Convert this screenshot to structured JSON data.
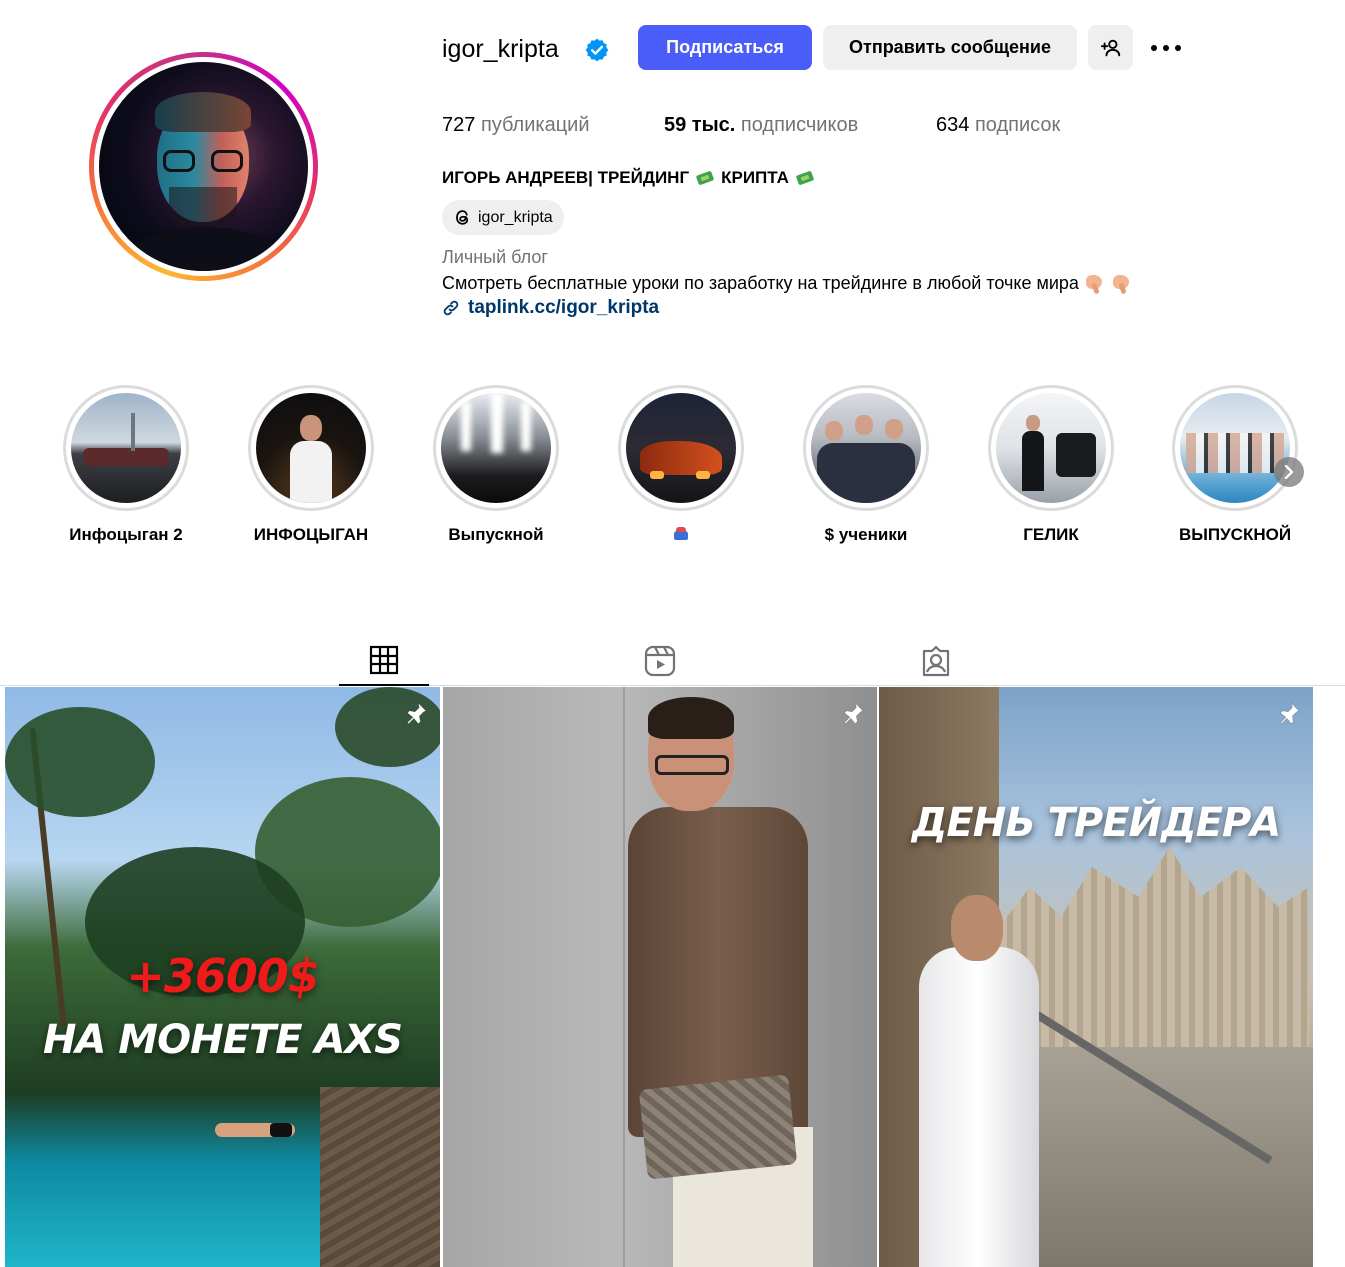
{
  "profile": {
    "username": "igor_kripta",
    "verified": true,
    "follow_label": "Подписаться",
    "message_label": "Отправить сообщение",
    "stats": {
      "posts_num": "727",
      "posts_label": "публикаций",
      "followers_num": "59 тыс.",
      "followers_label": "подписчиков",
      "following_num": "634",
      "following_label": "подписок"
    },
    "full_name_part1": "ИГОРЬ АНДРЕЕВ| ТРЕЙДИНГ",
    "full_name_part2": "КРИПТА",
    "threads_handle": "igor_kripta",
    "category": "Личный блог",
    "bio": "Смотреть бесплатные уроки по заработку на трейдинге в любой точке мира",
    "link": "taplink.cc/igor_kripta"
  },
  "highlights": [
    {
      "label": "Инфоцыган 2"
    },
    {
      "label": "ИНФОЦЫГАН"
    },
    {
      "label": "Выпускной"
    },
    {
      "label": ""
    },
    {
      "label": "$ ученики"
    },
    {
      "label": "ГЕЛИК"
    },
    {
      "label": "ВЫПУСКНОЙ"
    }
  ],
  "tabs": {
    "posts_icon": "grid-icon",
    "reels_icon": "reels-icon",
    "tagged_icon": "tagged-icon"
  },
  "posts": [
    {
      "caption_line1": "+3600$",
      "caption_line2": "НА МОНЕТЕ AXS",
      "pinned": true
    },
    {
      "caption_line1": "",
      "caption_line2": "",
      "pinned": true
    },
    {
      "caption_line1": "ДЕНЬ ТРЕЙДЕРА",
      "caption_line2": "",
      "pinned": true
    }
  ],
  "colors": {
    "follow_button": "#4a5df9",
    "secondary_button": "#efefef",
    "link": "#00376b",
    "muted_text": "#737373",
    "verified_badge": "#0095f6"
  }
}
